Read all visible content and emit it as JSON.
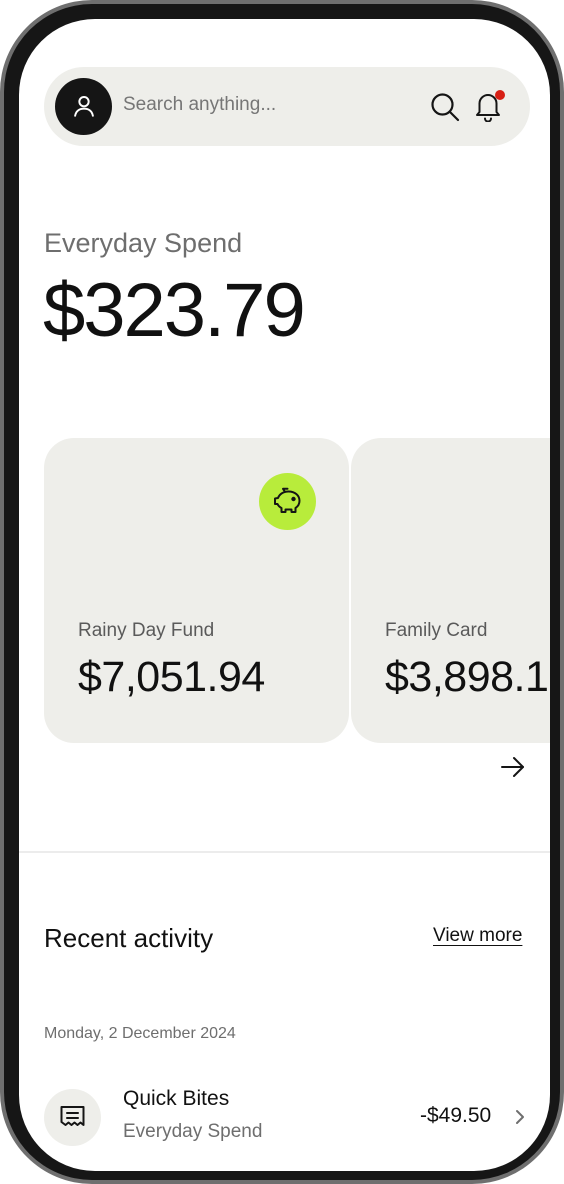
{
  "search": {
    "placeholder": "Search anything..."
  },
  "icons": {
    "avatar": "user-icon",
    "search": "search-icon",
    "notifications": "bell-icon",
    "notification_badge_color": "#d71f14",
    "savings": "piggy-bank-icon",
    "carousel_next": "arrow-right-icon",
    "transaction": "receipt-icon",
    "row_action": "chevron-right-icon"
  },
  "colors": {
    "accent": "#b8ec3b",
    "surface": "#eeeeea",
    "text_primary": "#111111",
    "text_secondary": "#6e6e6e"
  },
  "balance": {
    "label": "Everyday Spend",
    "amount": "$323.79"
  },
  "cards": [
    {
      "label": "Rainy Day Fund",
      "amount": "$7,051.94"
    },
    {
      "label": "Family Card",
      "amount": "$3,898.1"
    }
  ],
  "activity": {
    "title": "Recent activity",
    "view_more": "View more",
    "date": "Monday, 2 December 2024",
    "transactions": [
      {
        "name": "Quick Bites",
        "account": "Everyday Spend",
        "amount": "-$49.50"
      }
    ]
  }
}
